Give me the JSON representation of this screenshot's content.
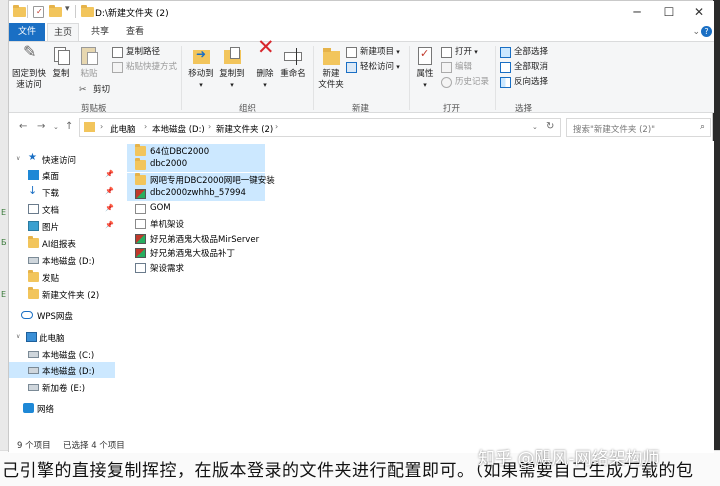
{
  "window": {
    "title": "D:\\新建文件夹 (2)"
  },
  "tabs": [
    {
      "label": "文件"
    },
    {
      "label": "主页"
    },
    {
      "label": "共享"
    },
    {
      "label": "查看"
    }
  ],
  "ribbon": {
    "clipboard": {
      "pin_label_1": "固定到快",
      "pin_label_2": "速访问",
      "copy_label": "复制",
      "paste_label": "粘贴",
      "copy_path_label": "复制路径",
      "paste_shortcut_label": "粘贴快捷方式",
      "cut_label": "剪切",
      "group_label": "剪贴板"
    },
    "organize": {
      "move_to_label": "移动到",
      "copy_to_label": "复制到",
      "delete_label": "删除",
      "rename_label": "重命名",
      "group_label": "组织"
    },
    "new": {
      "new_folder_label_1": "新建",
      "new_folder_label_2": "文件夹",
      "new_item_label": "新建项目",
      "easy_access_label": "轻松访问",
      "group_label": "新建"
    },
    "open": {
      "properties_label": "属性",
      "open_label": "打开",
      "edit_label": "编辑",
      "history_label": "历史记录",
      "group_label": "打开"
    },
    "select": {
      "select_all_label": "全部选择",
      "select_none_label": "全部取消",
      "invert_label": "反向选择",
      "group_label": "选择"
    }
  },
  "address": {
    "crumbs": [
      "此电脑",
      "本地磁盘 (D:)",
      "新建文件夹 (2)"
    ],
    "search_placeholder": "搜索\"新建文件夹 (2)\""
  },
  "nav_pane": {
    "items": [
      {
        "label": "快速访问",
        "icon": "star-icon"
      },
      {
        "label": "桌面",
        "icon": "desktop-icon"
      },
      {
        "label": "下载",
        "icon": "download-icon"
      },
      {
        "label": "文档",
        "icon": "documents-icon"
      },
      {
        "label": "图片",
        "icon": "pictures-icon"
      },
      {
        "label": "AI组报表",
        "icon": "folder-icon"
      },
      {
        "label": "本地磁盘 (D:)",
        "icon": "drive-icon"
      },
      {
        "label": "发贴",
        "icon": "folder-icon"
      },
      {
        "label": "新建文件夹 (2)",
        "icon": "folder-icon"
      },
      {
        "label": "WPS网盘",
        "icon": "cloud-icon"
      },
      {
        "label": "此电脑",
        "icon": "pc-icon"
      },
      {
        "label": "本地磁盘 (C:)",
        "icon": "drive-icon"
      },
      {
        "label": "本地磁盘 (D:)",
        "icon": "drive-icon"
      },
      {
        "label": "新加卷 (E:)",
        "icon": "drive-icon"
      },
      {
        "label": "网络",
        "icon": "network-icon"
      }
    ]
  },
  "files": [
    {
      "name": "64位DBC2000",
      "icon": "folder-icon",
      "selected": true
    },
    {
      "name": "dbc2000",
      "icon": "folder-icon",
      "selected": true
    },
    {
      "name": "网吧专用DBC2000网吧一键安装",
      "icon": "folder-icon",
      "selected": true
    },
    {
      "name": "dbc2000zwhhb_57994",
      "icon": "archive-icon",
      "selected": true
    },
    {
      "name": "GOM",
      "icon": "document-icon",
      "selected": false
    },
    {
      "name": "单机架设",
      "icon": "document-icon",
      "selected": false
    },
    {
      "name": "好兄弟酒鬼大极品MirServer",
      "icon": "archive-icon",
      "selected": false
    },
    {
      "name": "好兄弟酒鬼大极品补丁",
      "icon": "archive-icon",
      "selected": false
    },
    {
      "name": "架设需求",
      "icon": "text-file-icon",
      "selected": false
    }
  ],
  "status": {
    "item_count": "9 个项目",
    "selected_count": "已选择 4 个项目"
  },
  "background": {
    "bottom_text": "己引擎的直接复制挥控，在版本登录的文件夹进行配置即可。（如果需要自己生成万载的包",
    "watermark": "知乎 @飓风-网络架构师"
  },
  "colors": {
    "accent": "#1a6fc4",
    "selection": "#cce8ff",
    "folder": "#f2c55c"
  }
}
